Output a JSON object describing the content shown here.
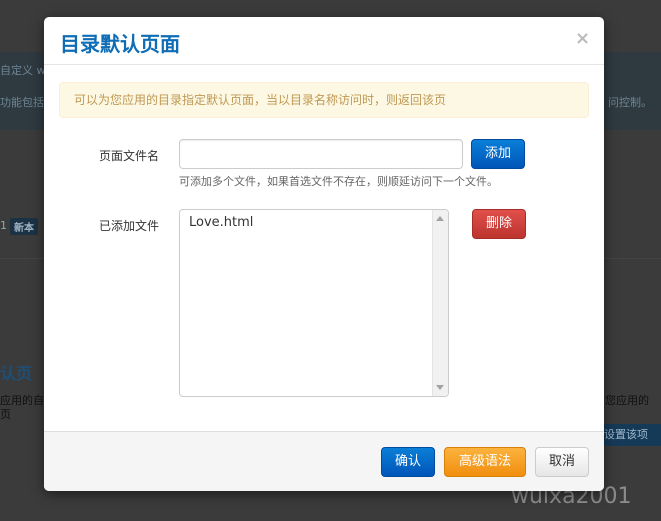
{
  "background": {
    "top_left_text": "自定义 w",
    "line2_text": "功能包括",
    "line2_right": "问控制。",
    "row_number": "1",
    "badge": "新本",
    "heading": "认页",
    "text_a": "应用的自",
    "text_b": "页",
    "text_right": "您应用的",
    "button_right": "设置该项",
    "watermark": "wuixa2001"
  },
  "modal": {
    "title": "目录默认页面",
    "close_glyph": "×",
    "alert": "可以为您应用的目录指定默认页面，当以目录名称访问时，则返回该页",
    "file_label": "页面文件名",
    "file_input_value": "",
    "file_input_placeholder": "",
    "add_button": "添加",
    "help_text": "可添加多个文件，如果首选文件不存在，则顺延访问下一个文件。",
    "added_label": "已添加文件",
    "added_files": [
      "Love.html"
    ],
    "delete_button": "删除",
    "footer": {
      "confirm": "确认",
      "advanced": "高级语法",
      "cancel": "取消"
    }
  },
  "colors": {
    "title": "#0e6db5",
    "primary": "#0066cc",
    "danger": "#d9443f",
    "warning": "#f7a42a",
    "alert_bg": "#fcf8e3",
    "alert_text": "#c09853"
  }
}
